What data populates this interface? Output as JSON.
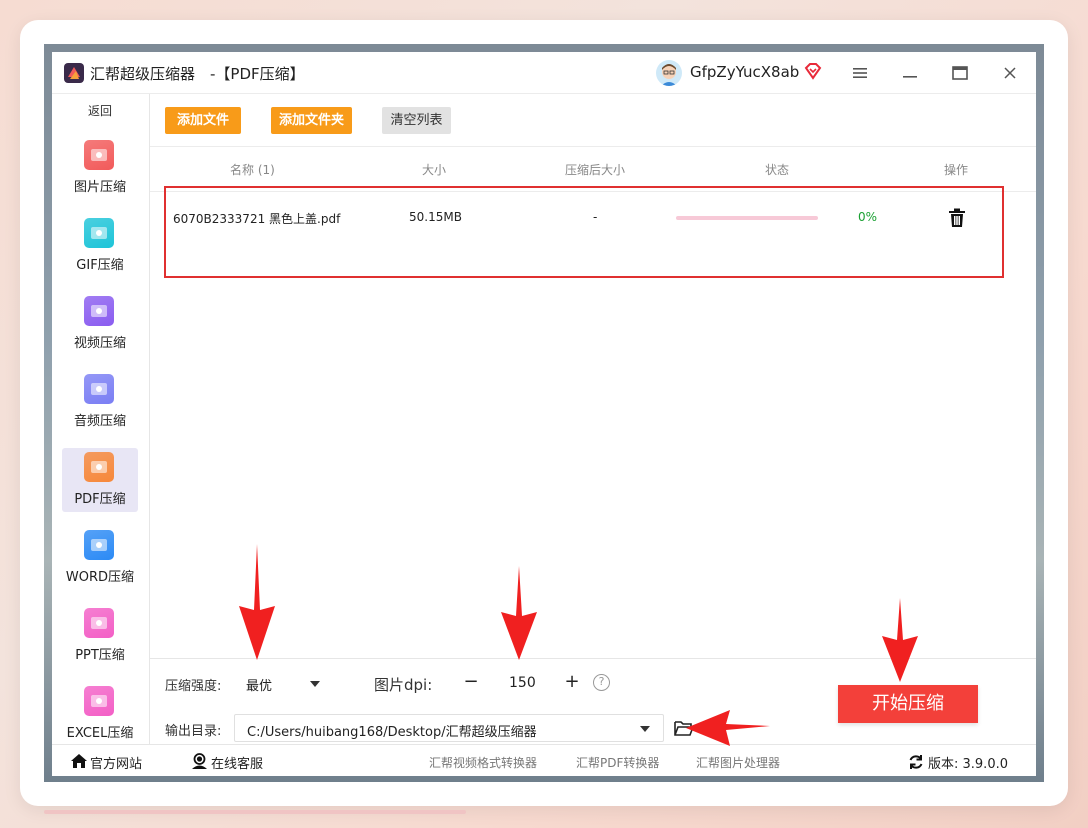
{
  "window": {
    "title": "汇帮超级压缩器　-【PDF压缩】",
    "user_name": "GfpZyYucX8ab"
  },
  "sidebar": {
    "back_label": "返回",
    "items": [
      {
        "label": "图片压缩",
        "icon": "image-icon",
        "color": "#f25a5a"
      },
      {
        "label": "GIF压缩",
        "icon": "gif-icon",
        "color": "#1dc4d8"
      },
      {
        "label": "视频压缩",
        "icon": "video-icon",
        "color": "#8a5cf0"
      },
      {
        "label": "音频压缩",
        "icon": "audio-icon",
        "color": "#7a7ef4"
      },
      {
        "label": "PDF压缩",
        "icon": "pdf-icon",
        "color": "#f7883a",
        "active": true
      },
      {
        "label": "WORD压缩",
        "icon": "word-icon",
        "color": "#2b8af5"
      },
      {
        "label": "PPT压缩",
        "icon": "ppt-icon",
        "color": "#f35fc6"
      },
      {
        "label": "EXCEL压缩",
        "icon": "excel-icon",
        "color": "#f35fc6"
      }
    ]
  },
  "toolbar": {
    "add_file_label": "添加文件",
    "add_folder_label": "添加文件夹",
    "clear_list_label": "清空列表"
  },
  "table": {
    "headers": {
      "name": "名称 (1)",
      "size": "大小",
      "compressed_size": "压缩后大小",
      "status": "状态",
      "actions": "操作"
    },
    "rows": [
      {
        "name": "6070B2333721 黑色上盖.pdf",
        "size": "50.15MB",
        "compressed_size": "-",
        "progress": 0,
        "progress_text": "0%"
      }
    ]
  },
  "settings": {
    "strength_label": "压缩强度:",
    "strength_value": "最优",
    "dpi_label": "图片dpi:",
    "dpi_minus": "−",
    "dpi_value": "150",
    "dpi_plus": "+",
    "help_symbol": "?",
    "output_label": "输出目录:",
    "output_path": "C:/Users/huibang168/Desktop/汇帮超级压缩器",
    "start_button": "开始压缩"
  },
  "statusbar": {
    "website_label": "官方网站",
    "support_label": "在线客服",
    "links": [
      "汇帮视频格式转换器",
      "汇帮PDF转换器",
      "汇帮图片处理器"
    ],
    "version_label": "版本: 3.9.0.0"
  },
  "colors": {
    "accent_orange": "#f89b19",
    "start_red": "#f3403a",
    "highlight_border": "#e03030",
    "annotation_arrow": "#f02020",
    "progress_green": "#1aa032"
  }
}
